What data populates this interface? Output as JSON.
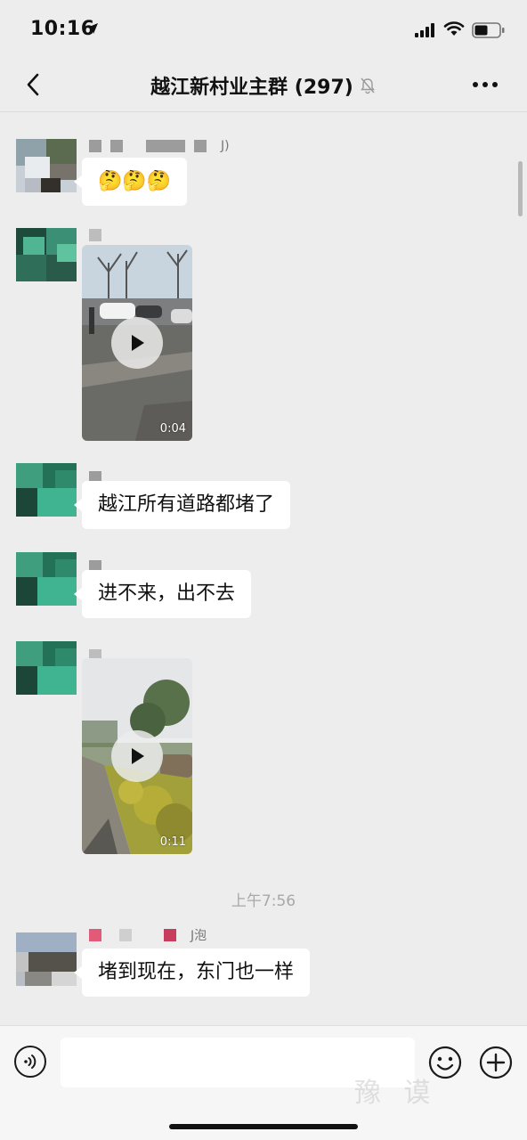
{
  "status_bar": {
    "time": "10:16"
  },
  "nav": {
    "title": "越江新村业主群 (297)"
  },
  "messages": [
    {
      "type": "text",
      "sender_suffix": "J)",
      "text": "🤔🤔🤔"
    },
    {
      "type": "video",
      "duration": "0:04"
    },
    {
      "type": "text",
      "text": "越江所有道路都堵了"
    },
    {
      "type": "text",
      "text": "进不来，出不去"
    },
    {
      "type": "video",
      "duration": "0:11"
    },
    {
      "type": "timestamp",
      "text": "上午7:56"
    },
    {
      "type": "text",
      "sender_suffix": "J泡",
      "text": "堵到现在，东门也一样"
    }
  ],
  "input": {
    "placeholder": ""
  },
  "watermark": "豫 谟",
  "icons": {
    "back": "chevron-left-icon",
    "mute": "bell-off-icon",
    "more": "ellipsis-icon",
    "play": "play-icon",
    "voice": "voice-icon",
    "emoji": "smiley-icon",
    "add": "plus-circle-icon"
  },
  "colors": {
    "background": "#ededed",
    "bubble": "#ffffff",
    "input_bar": "#f6f6f6"
  }
}
